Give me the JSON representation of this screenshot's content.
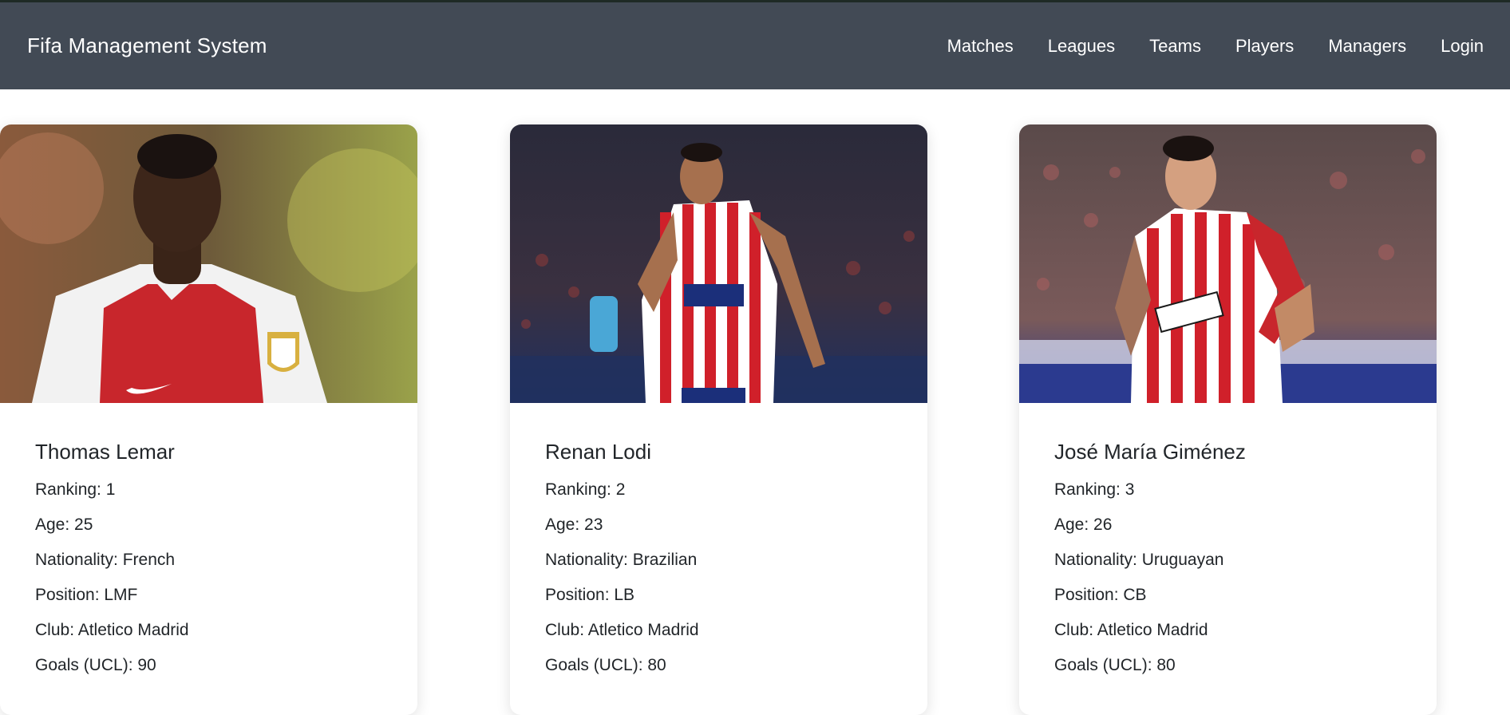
{
  "navbar": {
    "brand": "Fifa Management System",
    "links": [
      "Matches",
      "Leagues",
      "Teams",
      "Players",
      "Managers",
      "Login"
    ]
  },
  "players": [
    {
      "name": "Thomas Lemar",
      "ranking": "Ranking: 1",
      "age": "Age: 25",
      "nationality": "Nationality: French",
      "position": "Position: LMF",
      "club": "Club: Atletico Madrid",
      "goals": "Goals (UCL): 90",
      "photo": "player-photo"
    },
    {
      "name": "Renan Lodi",
      "ranking": "Ranking: 2",
      "age": "Age: 23",
      "nationality": "Nationality: Brazilian",
      "position": "Position: LB",
      "club": "Club: Atletico Madrid",
      "goals": "Goals (UCL): 80",
      "photo": "player-photo"
    },
    {
      "name": "José María Giménez",
      "ranking": "Ranking: 3",
      "age": "Age: 26",
      "nationality": "Nationality: Uruguayan",
      "position": "Position: CB",
      "club": "Club: Atletico Madrid",
      "goals": "Goals (UCL): 80",
      "photo": "player-photo"
    }
  ],
  "colors": {
    "navbar_bg": "#424a55",
    "text": "#212529"
  }
}
